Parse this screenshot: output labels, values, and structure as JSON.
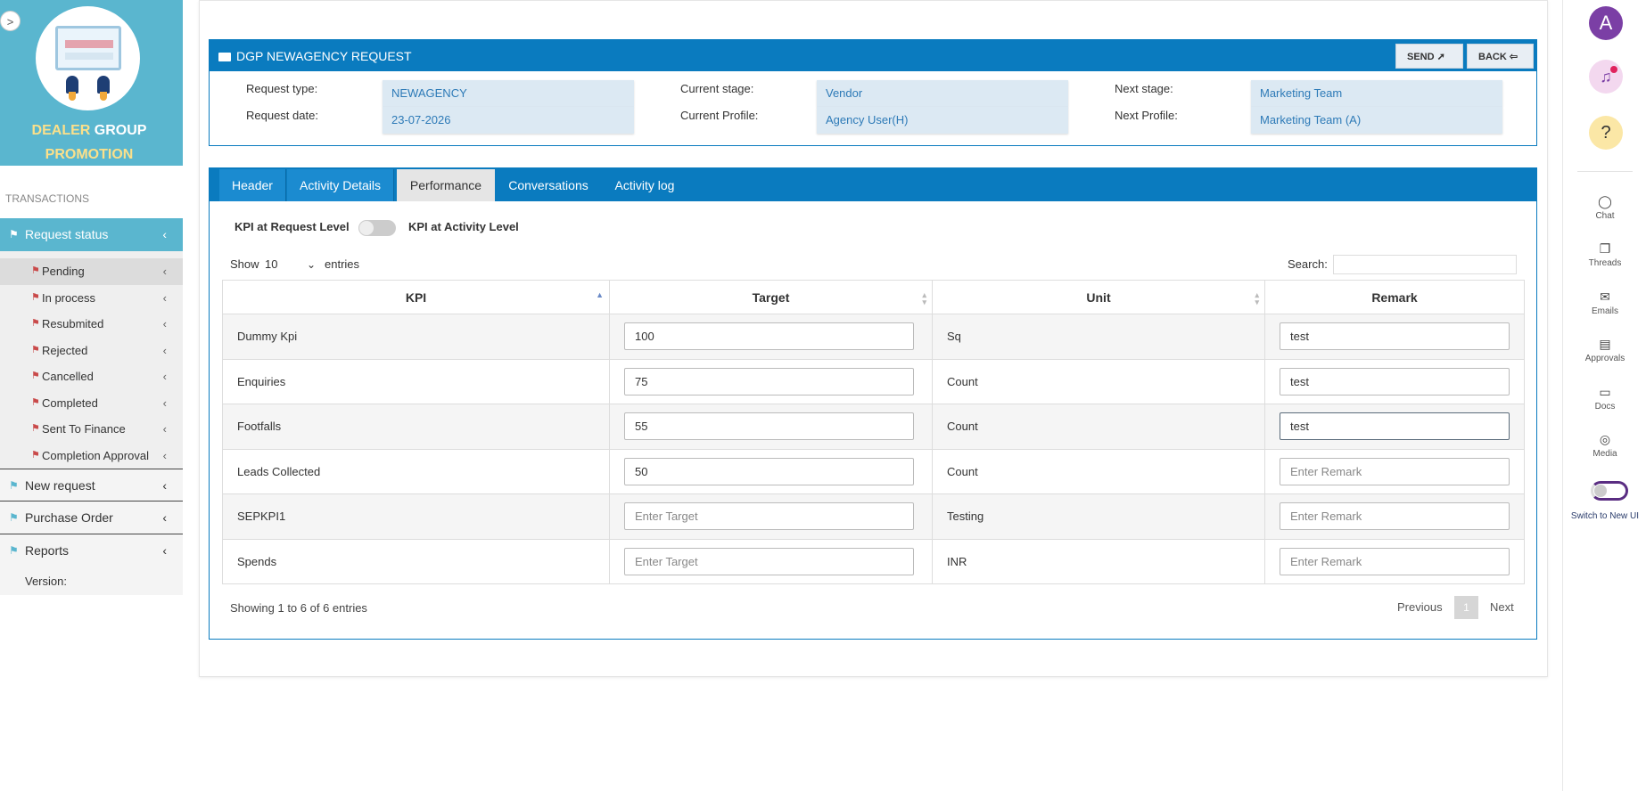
{
  "sidebar": {
    "toggle_glyph": ">",
    "brand": {
      "line1_a": "DEALER",
      "line1_b": "GROUP",
      "line2": "PROMOTION"
    },
    "section_label": "TRANSACTIONS",
    "request_status_label": "Request status",
    "sub_items": [
      {
        "label": "Pending"
      },
      {
        "label": "In process"
      },
      {
        "label": "Resubmited"
      },
      {
        "label": "Rejected"
      },
      {
        "label": "Cancelled"
      },
      {
        "label": "Completed"
      },
      {
        "label": "Sent To Finance"
      },
      {
        "label": "Completion Approval"
      }
    ],
    "new_request_label": "New request",
    "purchase_order_label": "Purchase Order",
    "reports_label": "Reports",
    "version_label": "Version:"
  },
  "request": {
    "title": "DGP NEWAGENCY REQUEST",
    "send_label": "SEND",
    "back_label": "BACK",
    "fields": {
      "request_type_label": "Request type:",
      "request_type_value": "NEWAGENCY",
      "request_date_label": "Request date:",
      "request_date_value": "23-07-2026",
      "current_stage_label": "Current stage:",
      "current_stage_value": "Vendor",
      "current_profile_label": "Current Profile:",
      "current_profile_value": "Agency User(H)",
      "next_stage_label": "Next stage:",
      "next_stage_value": "Marketing Team",
      "next_profile_label": "Next Profile:",
      "next_profile_value": "Marketing Team (A)"
    }
  },
  "tabs": [
    {
      "label": "Header"
    },
    {
      "label": "Activity Details"
    },
    {
      "label": "Performance"
    },
    {
      "label": "Conversations"
    },
    {
      "label": "Activity log"
    }
  ],
  "performance": {
    "kpi_request_label": "KPI at Request Level",
    "kpi_activity_label": "KPI at Activity Level",
    "show_label": "Show",
    "show_value": "10",
    "entries_label": "entries",
    "search_label": "Search:",
    "columns": [
      "KPI",
      "Target",
      "Unit",
      "Remark"
    ],
    "rows": [
      {
        "kpi": "Dummy Kpi",
        "target": "100",
        "unit": "Sq",
        "remark": "test"
      },
      {
        "kpi": "Enquiries",
        "target": "75",
        "unit": "Count",
        "remark": "test"
      },
      {
        "kpi": "Footfalls",
        "target": "55",
        "unit": "Count",
        "remark": "test"
      },
      {
        "kpi": "Leads Collected",
        "target": "50",
        "unit": "Count",
        "remark": ""
      },
      {
        "kpi": "SEPKPI1",
        "target": "",
        "unit": "Testing",
        "remark": ""
      },
      {
        "kpi": "Spends",
        "target": "",
        "unit": "INR",
        "remark": ""
      }
    ],
    "target_placeholder": "Enter Target",
    "remark_placeholder": "Enter Remark",
    "info_text": "Showing 1 to 6 of 6 entries",
    "prev_label": "Previous",
    "page_number": "1",
    "next_label": "Next"
  },
  "rail": {
    "avatar_letter": "A",
    "items": [
      {
        "label": "Chat",
        "icon": "chat-icon",
        "glyph": "◯"
      },
      {
        "label": "Threads",
        "icon": "threads-icon",
        "glyph": "❐"
      },
      {
        "label": "Emails",
        "icon": "email-icon",
        "glyph": "✉"
      },
      {
        "label": "Approvals",
        "icon": "approvals-icon",
        "glyph": "▤"
      },
      {
        "label": "Docs",
        "icon": "folder-icon",
        "glyph": "▭"
      },
      {
        "label": "Media",
        "icon": "database-icon",
        "glyph": "◎"
      }
    ],
    "switch_label": "Switch to New UI"
  },
  "colors": {
    "primary": "#0a7bbf",
    "sidebar_accent": "#5ab6cf",
    "avatar": "#7b3fa5"
  }
}
